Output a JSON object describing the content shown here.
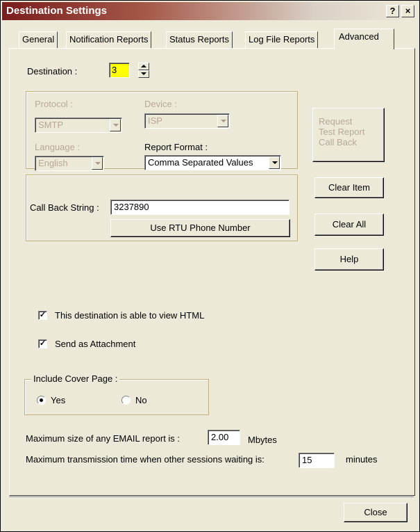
{
  "window": {
    "title": "Destination Settings",
    "help_glyph": "?",
    "close_glyph": "×"
  },
  "tabs": [
    {
      "label": "General"
    },
    {
      "label": "Notification Reports"
    },
    {
      "label": "Status Reports"
    },
    {
      "label": "Log File Reports"
    },
    {
      "label": "Advanced",
      "active": true
    }
  ],
  "destination": {
    "label": "Destination :",
    "value": "3"
  },
  "protocol": {
    "label": "Protocol :",
    "value": "SMTP",
    "enabled": false
  },
  "device": {
    "label": "Device :",
    "value": "ISP",
    "enabled": false
  },
  "language": {
    "label": "Language :",
    "value": "English",
    "enabled": false
  },
  "report_format": {
    "label": "Report Format :",
    "value": "Comma Separated Values",
    "enabled": true
  },
  "callback": {
    "label": "Call Back String :",
    "value": "3237890",
    "use_rtu_button": "Use RTU Phone Number"
  },
  "side_buttons": {
    "request_line1": "Request",
    "request_line2": "Test Report",
    "request_line3": "Call Back",
    "clear_item": "Clear Item",
    "clear_all": "Clear All",
    "help": "Help"
  },
  "options": {
    "view_html": {
      "label": "This destination is able to view HTML",
      "checked": true
    },
    "send_attachment": {
      "label": "Send as Attachment",
      "checked": true
    }
  },
  "cover_page": {
    "legend": "Include Cover Page :",
    "yes_label": "Yes",
    "no_label": "No",
    "selected": "Yes"
  },
  "limits": {
    "max_size_label": "Maximum size of any EMAIL report is :",
    "max_size_value": "2.00",
    "max_size_unit": "Mbytes",
    "max_time_label": "Maximum transmission time when other sessions waiting is:",
    "max_time_value": "15",
    "max_time_unit": "minutes"
  },
  "footer": {
    "close_button": "Close"
  },
  "colors": {
    "dialog_bg": "#ece9d8",
    "title_start": "#7a1d1d",
    "disabled_text": "#b8a898"
  }
}
